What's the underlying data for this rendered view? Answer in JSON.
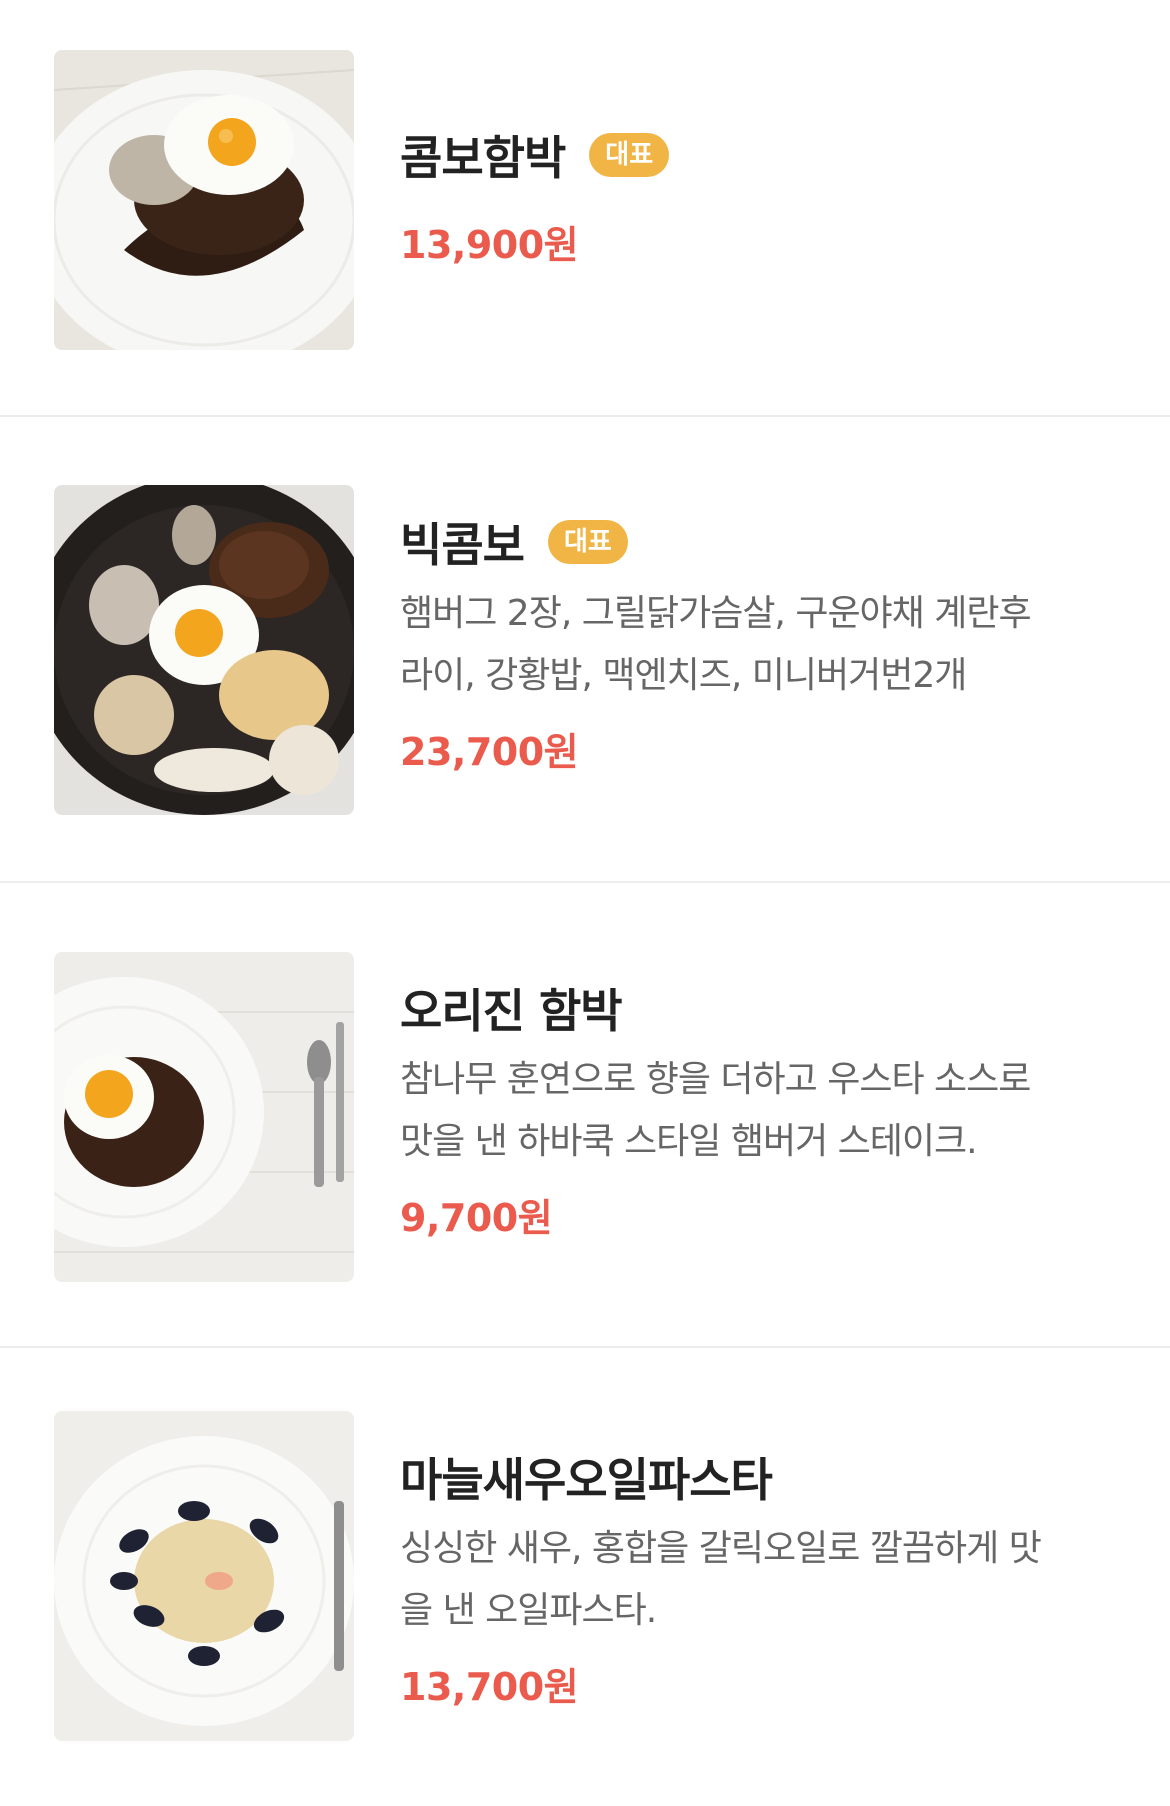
{
  "menu": {
    "items": [
      {
        "name": "콤보함박",
        "badge": "대표",
        "description": "",
        "price": "13,900원",
        "image": "combo-hamburg-steak-photo"
      },
      {
        "name": "빅콤보",
        "badge": "대표",
        "description_lines": [
          "햄버그 2장, 그릴닭가슴살, 구운야채 계란후",
          "라이, 강황밥, 맥엔치즈, 미니버거번2개"
        ],
        "price": "23,700원",
        "image": "big-combo-skillet-photo"
      },
      {
        "name": "오리진 함박",
        "badge": "",
        "description_lines": [
          "참나무 훈연으로 향을 더하고 우스타 소스로",
          "맛을 낸 하바쿡 스타일 햄버거 스테이크."
        ],
        "price": "9,700원",
        "image": "origin-hamburg-steak-photo"
      },
      {
        "name": "마늘새우오일파스타",
        "badge": "",
        "description_lines": [
          "싱싱한 새우, 홍합을 갈릭오일로 깔끔하게 맛",
          "을 낸 오일파스타."
        ],
        "price": "13,700원",
        "image": "garlic-shrimp-oil-pasta-photo"
      }
    ]
  },
  "colors": {
    "price": "#ea5a4d",
    "badge_bg": "#f0b545",
    "divider": "#ececec"
  }
}
